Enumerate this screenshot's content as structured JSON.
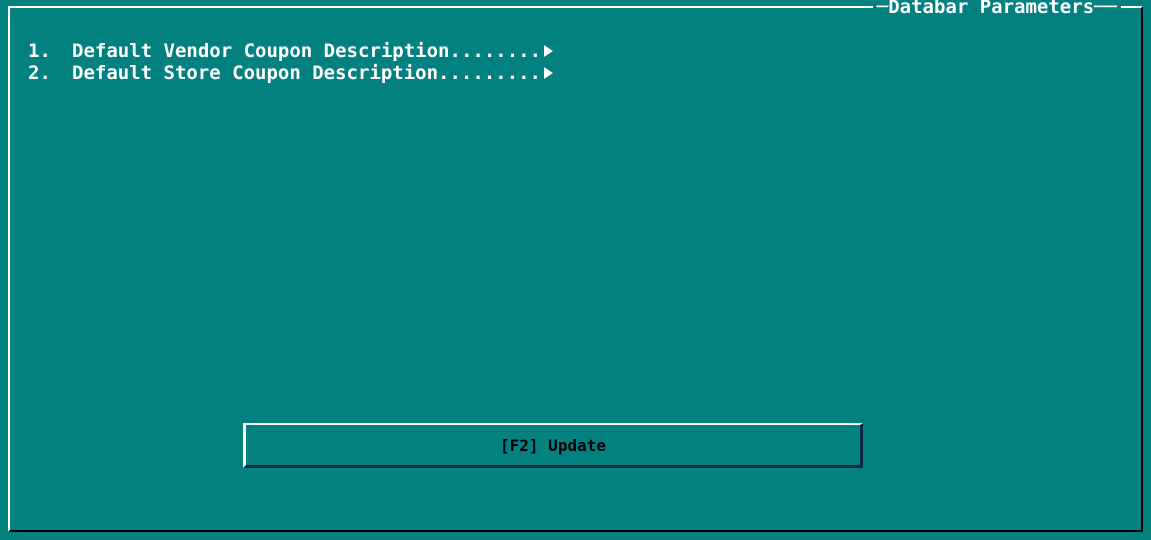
{
  "window": {
    "title": "Databar Parameters"
  },
  "menu": {
    "items": [
      {
        "number": "1.",
        "label": "Default Vendor Coupon Description",
        "dots": "........",
        "arrow": "right-arrow-icon"
      },
      {
        "number": "2.",
        "label": "Default Store Coupon Description",
        "dots": ".........",
        "arrow": "right-arrow-icon"
      }
    ]
  },
  "actions": {
    "update_label": "[F2] Update"
  },
  "colors": {
    "background": "#038080",
    "text": "#ffffff",
    "button_text": "#000000"
  }
}
